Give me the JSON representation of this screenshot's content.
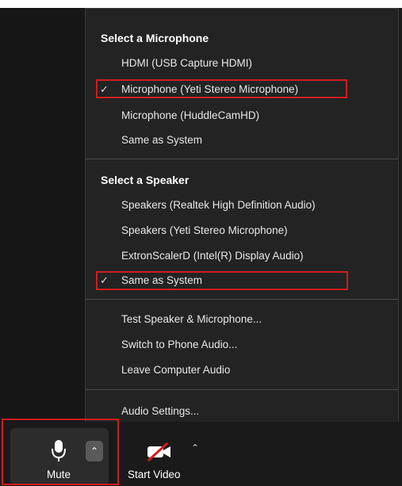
{
  "menu": {
    "microphone_section": {
      "title": "Select a Microphone",
      "items": [
        {
          "label": "HDMI (USB Capture HDMI)",
          "checked": false
        },
        {
          "label": "Microphone (Yeti Stereo Microphone)",
          "checked": true
        },
        {
          "label": "Microphone (HuddleCamHD)",
          "checked": false
        },
        {
          "label": "Same as System",
          "checked": false
        }
      ]
    },
    "speaker_section": {
      "title": "Select a Speaker",
      "items": [
        {
          "label": "Speakers (Realtek High Definition Audio)",
          "checked": false
        },
        {
          "label": "Speakers (Yeti Stereo Microphone)",
          "checked": false
        },
        {
          "label": "ExtronScalerD (Intel(R) Display Audio)",
          "checked": false
        },
        {
          "label": "Same as System",
          "checked": true
        }
      ]
    },
    "actions": [
      {
        "label": "Test Speaker & Microphone..."
      },
      {
        "label": "Switch to Phone Audio..."
      },
      {
        "label": "Leave Computer Audio"
      }
    ],
    "settings": {
      "label": "Audio Settings..."
    },
    "check_glyph": "✓"
  },
  "toolbar": {
    "mute": {
      "label": "Mute",
      "icon": "microphone-icon"
    },
    "start_video": {
      "label": "Start Video",
      "icon": "video-off-icon"
    },
    "caret_glyph": "⌃"
  },
  "colors": {
    "highlight": "#d11c1c",
    "menu_background": "#232323",
    "toolbar_background": "#1a1a1a"
  }
}
